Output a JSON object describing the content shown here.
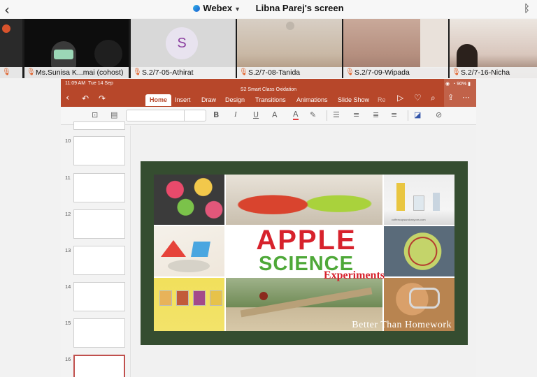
{
  "webex": {
    "app_name": "Webex",
    "screen_title": "Libna Parej's screen",
    "back_icon": "chevron-left-icon",
    "bluetooth_icon": "bluetooth-icon"
  },
  "participants": [
    {
      "name": "",
      "muted": true
    },
    {
      "name": "Ms.Sunisa K...mai (cohost)",
      "muted": true
    },
    {
      "name": "S.2/7-05-Athirat",
      "muted": true,
      "avatar_letter": "S"
    },
    {
      "name": "S.2/7-08-Tanida",
      "muted": true
    },
    {
      "name": "S.2/7-09-Wipada",
      "muted": true
    },
    {
      "name": "S.2/7-16-Nicha",
      "muted": true
    }
  ],
  "powerpoint": {
    "status_time": "11:09 AM",
    "status_date": "Tue 14 Sep",
    "document_title": "S2 Smart Class Oxidation",
    "battery": "90%",
    "tabs": [
      "Home",
      "Insert",
      "Draw",
      "Design",
      "Transitions",
      "Animations",
      "Slide Show",
      "Re"
    ],
    "active_tab": "Home",
    "format_buttons": {
      "bold": "B",
      "italic": "I",
      "underline": "U",
      "font_size": "A",
      "font_color": "A"
    },
    "slide_numbers": [
      "10",
      "11",
      "12",
      "13",
      "14",
      "15",
      "16"
    ],
    "selected_slide": "16",
    "slide": {
      "title_line1": "APPLE",
      "title_line2": "SCIENCE",
      "title_line3": "Experiments",
      "footer": "Better Than Homework",
      "credit": "coffeecupsandcrayons.com",
      "colors": {
        "frame": "#354d30",
        "apple": "#d7222c",
        "science": "#4ea838"
      }
    }
  }
}
